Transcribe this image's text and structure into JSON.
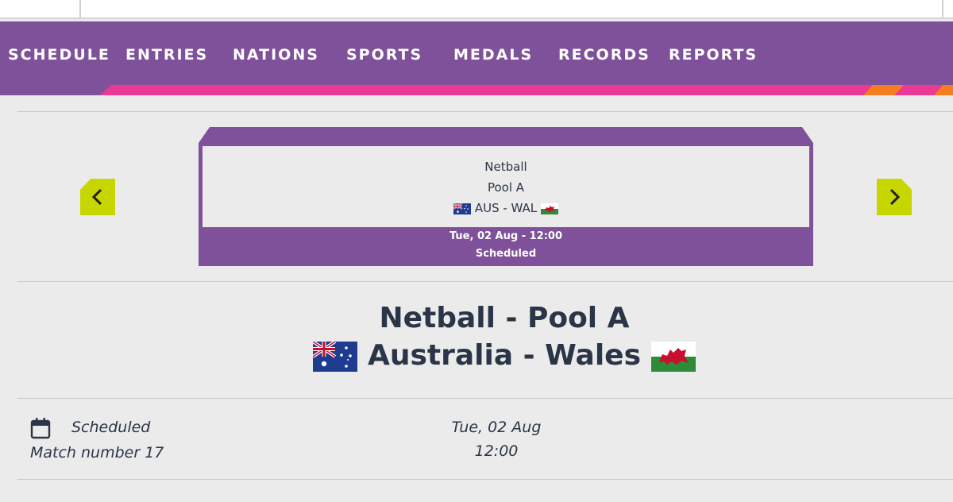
{
  "nav": {
    "items": [
      "Schedule",
      "Entries",
      "Nations",
      "Sports",
      "Medals",
      "Records",
      "Reports"
    ]
  },
  "card": {
    "sport": "Netball",
    "pool": "Pool A",
    "matchup": "AUS - WAL",
    "datetime": "Tue, 02 Aug - 12:00",
    "status": "Scheduled"
  },
  "heading": {
    "title": "Netball - Pool A",
    "teams": "Australia - Wales"
  },
  "details": {
    "status": "Scheduled",
    "match_number": "Match number 17",
    "date": "Tue, 02 Aug",
    "time": "12:00"
  },
  "colors": {
    "nav_purple": "#7f519b",
    "accent_pink": "#ea3a96",
    "accent_orange": "#f57f20",
    "arrow_lime": "#c8d600",
    "text_dark": "#2a3547"
  },
  "icons": [
    "chevron-left-icon",
    "chevron-right-icon",
    "calendar-icon",
    "australia-flag-icon",
    "wales-flag-icon"
  ]
}
